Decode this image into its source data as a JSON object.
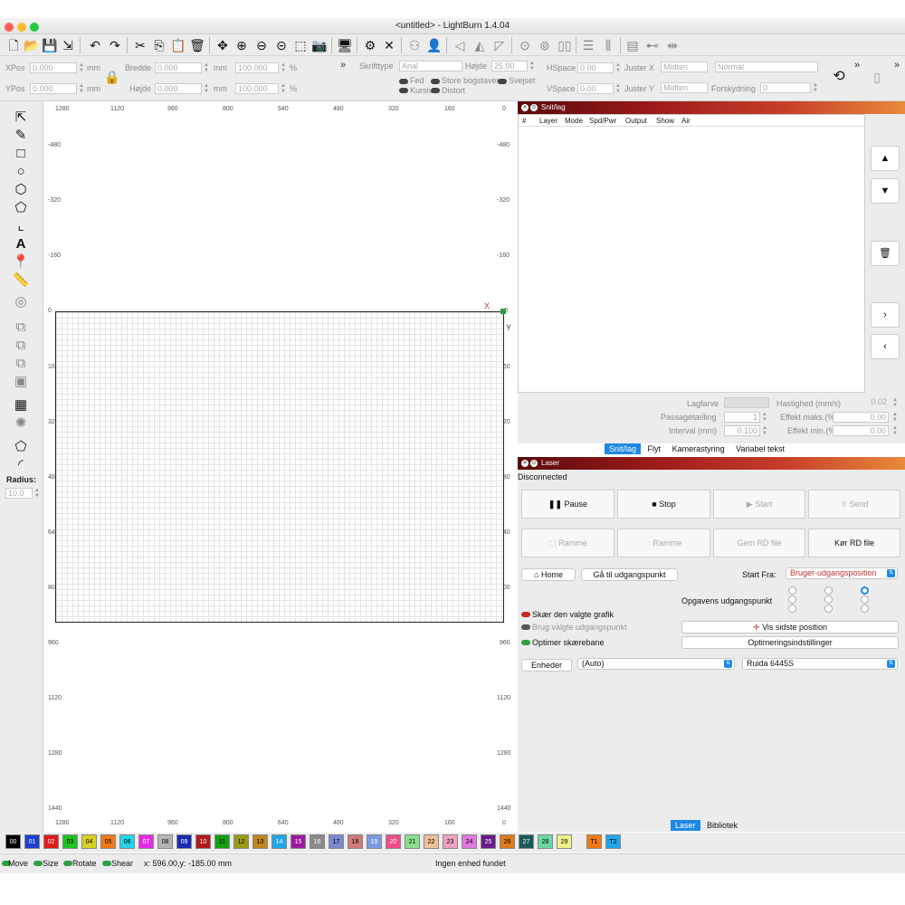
{
  "app": {
    "title": "<untitled> - LightBurn 1.4.04"
  },
  "toolbar": {
    "icons": [
      "new-file-icon",
      "open-file-icon",
      "save-file-icon",
      "import-icon",
      "undo-icon",
      "redo-icon",
      "cut-icon",
      "copy-icon",
      "paste-icon",
      "delete-icon",
      "move-icon",
      "zoom-in-icon",
      "zoom-out-icon",
      "zoom-frame-icon",
      "camera-icon",
      "monitor-icon",
      "settings-icon",
      "tools-icon",
      "group-icon",
      "user-icon",
      "mirror-icon",
      "align-icon",
      "send-icon",
      "target-icon",
      "center-icon",
      "distribute-icon",
      "align-horizontal-icon",
      "align-vertical-icon",
      "dock-icon",
      "anchor-icon"
    ]
  },
  "props": {
    "xpos_label": "XPos",
    "xpos_value": "0.000",
    "ypos_label": "YPos",
    "ypos_value": "0.000",
    "unit_mm": "mm",
    "width_label": "Bredde",
    "width_value": "0.000",
    "height_label": "Højde",
    "height_value": "0.000",
    "scale_w": "100.000",
    "scale_h": "100.000",
    "percent": "%",
    "font_label": "Skrifttype",
    "font_value": "Arial",
    "fontheight_label": "Højde",
    "fontheight_value": "25.00",
    "hspace_label": "HSpace",
    "hspace_value": "0.00",
    "vspace_label": "VSpace",
    "vspace_value": "0.00",
    "alignx_label": "Juster X",
    "alignx_value": "Midten",
    "aligny_label": "Juster Y",
    "aligny_value": "Midten",
    "style_value": "Normal",
    "offset_label": "Forskydning",
    "offset_value": "0",
    "bold": "Fed",
    "italic": "Kursiv",
    "caps": "Store bogstaver",
    "distort": "Distort",
    "welded": "Svejset",
    "more": "»"
  },
  "lefttools": {
    "icons": [
      "select-icon",
      "draw-line-icon",
      "rectangle-icon",
      "ellipse-icon",
      "polygon-icon",
      "pentagon-icon",
      "bracket-icon",
      "text-icon",
      "position-pin-icon",
      "measure-icon",
      "offset-icon",
      "boolean-union-icon",
      "boolean-subtract-icon",
      "boolean-intersect-icon",
      "weld-icon",
      "grid-array-icon",
      "circular-array-icon",
      "corner-icon",
      "rounded-corner-icon"
    ],
    "text_glyph": "A",
    "radius_label": "Radius:",
    "radius_value": "10.0"
  },
  "ruler": {
    "top": [
      "1280",
      "1120",
      "960",
      "800",
      "640",
      "480",
      "320",
      "160",
      "0"
    ],
    "left": [
      "-480",
      "-320",
      "-160",
      "0",
      "160",
      "320",
      "480",
      "640",
      "800",
      "960",
      "1120",
      "1280",
      "1440"
    ],
    "right": [
      "-480",
      "-320",
      "-160",
      "0",
      "160",
      "320",
      "480",
      "640",
      "800",
      "960",
      "1120",
      "1280",
      "1440"
    ],
    "bottom": [
      "1280",
      "1120",
      "960",
      "800",
      "640",
      "480",
      "320",
      "160",
      "0"
    ],
    "x_marker": "X",
    "y_marker": "Y"
  },
  "cuts": {
    "title": "Snit/lag",
    "columns": [
      "#",
      "Layer",
      "Mode",
      "Spd/Pwr",
      "Output",
      "Show",
      "Air"
    ],
    "side_buttons": [
      "▲",
      "▼",
      "🗑",
      "›",
      "‹"
    ],
    "fields": {
      "color_label": "Lagfarve",
      "speed_label": "Hastighed (mm/s)",
      "speed_value": "0.02",
      "passes_label": "Passagetælling",
      "passes_value": "1",
      "maxpower_label": "Effekt maks.(%)",
      "maxpower_value": "0.00",
      "interval_label": "Interval (mm)",
      "interval_value": "0.100",
      "minpower_label": "Effekt min.(%)",
      "minpower_value": "0.00"
    },
    "tabs": [
      "Snit/lag",
      "Flyt",
      "Kamerastyring",
      "Variabel tekst"
    ]
  },
  "laser": {
    "title": "Laser",
    "status": "Disconnected",
    "pause": "Pause",
    "stop": "Stop",
    "start": "Start",
    "send": "Send",
    "frame1": "Ramme",
    "frame2": "Ramme",
    "save_rd": "Gem RD file",
    "run_rd": "Kør RD file",
    "home": "Home",
    "goto_origin": "Gå til udgangspunkt",
    "start_from_label": "Start Fra:",
    "start_from_value": "Bruger-udgangsposition",
    "job_origin_label": "Opgavens udgangspunkt",
    "cut_selected": "Skær den valgte grafik",
    "use_origin": "Brug valgte udgangspunkt",
    "optimize_path": "Optimer skærebane",
    "show_last": "Vis sidste position",
    "optimize_settings": "Optimeringsindstillinger",
    "units_button": "Enheder",
    "port_value": "(Auto)",
    "device_value": "Ruida 6445S",
    "bottom_tabs": [
      "Laser",
      "Bibliotek"
    ]
  },
  "palette": {
    "swatches": [
      {
        "label": "00",
        "color": "#000000",
        "text": "#ffffff"
      },
      {
        "label": "01",
        "color": "#1e3fd0",
        "text": "#ffffff"
      },
      {
        "label": "02",
        "color": "#e01b1b",
        "text": "#ffffff"
      },
      {
        "label": "03",
        "color": "#1fc21f",
        "text": "#000000"
      },
      {
        "label": "04",
        "color": "#d8d020",
        "text": "#000000"
      },
      {
        "label": "05",
        "color": "#f07a14",
        "text": "#000000"
      },
      {
        "label": "06",
        "color": "#22d4e6",
        "text": "#000000"
      },
      {
        "label": "07",
        "color": "#e62ae6",
        "text": "#ffffff"
      },
      {
        "label": "08",
        "color": "#b4b4b4",
        "text": "#000000"
      },
      {
        "label": "09",
        "color": "#1a2ab0",
        "text": "#ffffff"
      },
      {
        "label": "10",
        "color": "#b01a1a",
        "text": "#ffffff"
      },
      {
        "label": "11",
        "color": "#14a014",
        "text": "#000000"
      },
      {
        "label": "12",
        "color": "#9a9a14",
        "text": "#000000"
      },
      {
        "label": "13",
        "color": "#c0861a",
        "text": "#000000"
      },
      {
        "label": "14",
        "color": "#22a6ea",
        "text": "#ffffff"
      },
      {
        "label": "15",
        "color": "#a01aa0",
        "text": "#ffffff"
      },
      {
        "label": "16",
        "color": "#8a8a8a",
        "text": "#ffffff"
      },
      {
        "label": "17",
        "color": "#7a8ad0",
        "text": "#000000"
      },
      {
        "label": "18",
        "color": "#d07a7a",
        "text": "#000000"
      },
      {
        "label": "19",
        "color": "#7a9ae0",
        "text": "#ffffff"
      },
      {
        "label": "20",
        "color": "#f04a8a",
        "text": "#ffffff"
      },
      {
        "label": "21",
        "color": "#8ae08a",
        "text": "#000000"
      },
      {
        "label": "22",
        "color": "#f0c09a",
        "text": "#000000"
      },
      {
        "label": "23",
        "color": "#f0a0c0",
        "text": "#000000"
      },
      {
        "label": "24",
        "color": "#e07ae0",
        "text": "#000000"
      },
      {
        "label": "25",
        "color": "#6a1a8a",
        "text": "#ffffff"
      },
      {
        "label": "26",
        "color": "#e07a1a",
        "text": "#000000"
      },
      {
        "label": "27",
        "color": "#1a5a5a",
        "text": "#ffffff"
      },
      {
        "label": "28",
        "color": "#6ad8a0",
        "text": "#000000"
      },
      {
        "label": "29",
        "color": "#f0f08a",
        "text": "#000000"
      },
      {
        "label": "T1",
        "color": "#f07a14",
        "text": "#000000"
      },
      {
        "label": "T2",
        "color": "#22a6ea",
        "text": "#000000"
      }
    ]
  },
  "status": {
    "move": "Move",
    "size": "Size",
    "rotate": "Rotate",
    "shear": "Shear",
    "coords": "x: 596.00,y: -185.00 mm",
    "device": "Ingen enhed fundet"
  },
  "colors": {
    "accent": "#1e88e5",
    "active_toggle": "#2ea043",
    "red_toggle": "#c62828"
  }
}
